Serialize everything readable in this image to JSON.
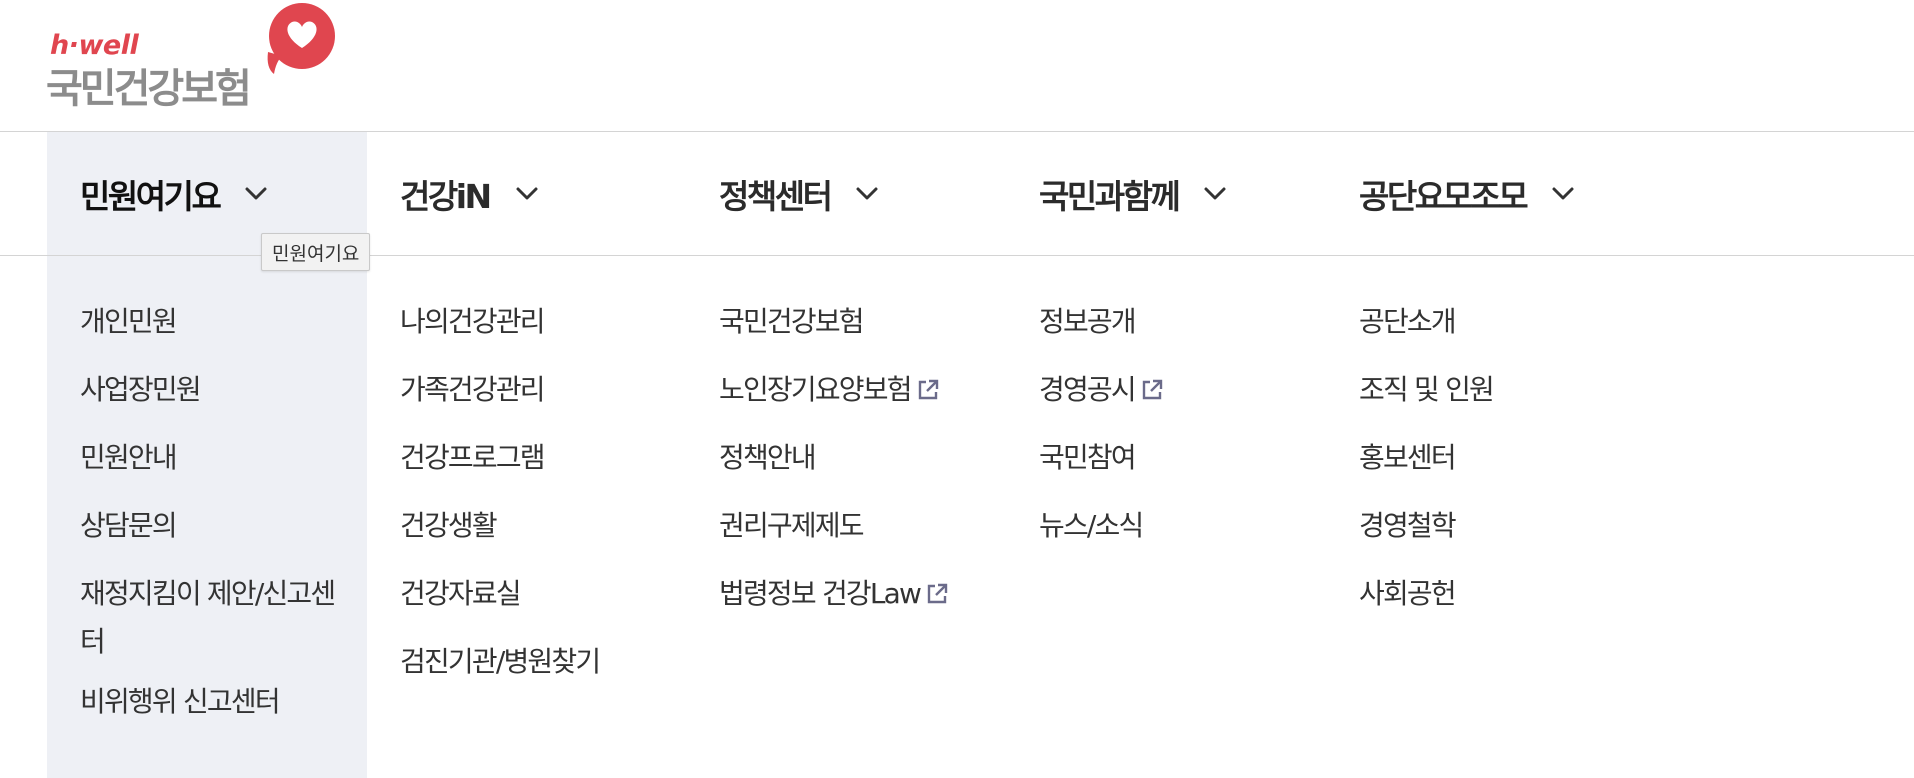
{
  "logo": {
    "tag": "h·well",
    "name": "국민건강보험",
    "brand_color": "#e0464f"
  },
  "tooltip": "민원여기요",
  "nav": {
    "active_bg": "#eef0f5",
    "items": [
      {
        "label": "민원여기요",
        "icon": "chevron-down-icon",
        "sub": [
          {
            "label": "개인민원"
          },
          {
            "label": "사업장민원"
          },
          {
            "label": "민원안내"
          },
          {
            "label": "상담문의"
          },
          {
            "label": "재정지킴이 제안/신고센터"
          },
          {
            "label": "비위행위 신고센터"
          }
        ]
      },
      {
        "label": "건강iN",
        "icon": "chevron-down-icon",
        "sub": [
          {
            "label": "나의건강관리"
          },
          {
            "label": "가족건강관리"
          },
          {
            "label": "건강프로그램"
          },
          {
            "label": "건강생활"
          },
          {
            "label": "건강자료실"
          },
          {
            "label": "검진기관/병원찾기"
          }
        ]
      },
      {
        "label": "정책센터",
        "icon": "chevron-down-icon",
        "sub": [
          {
            "label": "국민건강보험"
          },
          {
            "label": "노인장기요양보험",
            "icon": "external-link-icon"
          },
          {
            "label": "정책안내"
          },
          {
            "label": "권리구제제도"
          },
          {
            "label": "법령정보 건강Law",
            "icon": "external-link-icon"
          }
        ]
      },
      {
        "label": "국민과함께",
        "icon": "chevron-down-icon",
        "sub": [
          {
            "label": "정보공개"
          },
          {
            "label": "경영공시",
            "icon": "external-link-icon"
          },
          {
            "label": "국민참여"
          },
          {
            "label": "뉴스/소식"
          }
        ]
      },
      {
        "label": "공단요모조모",
        "icon": "chevron-down-icon",
        "sub": [
          {
            "label": "공단소개"
          },
          {
            "label": "조직 및 인원"
          },
          {
            "label": "홍보센터"
          },
          {
            "label": "경영철학"
          },
          {
            "label": "사회공헌"
          }
        ]
      }
    ]
  }
}
